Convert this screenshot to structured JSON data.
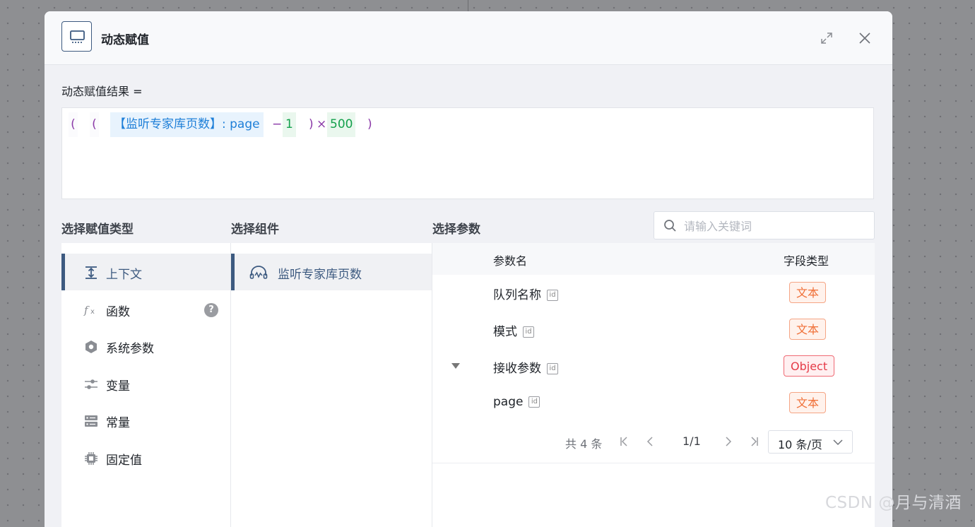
{
  "dialog": {
    "title": "动态赋值"
  },
  "expression": {
    "label": "动态赋值结果 =",
    "tokens": {
      "paren_open_1": "(",
      "paren_open_2": "(",
      "field": "【监听专家库页数】: page",
      "minus": "−",
      "num1": "1",
      "paren_close_1": ")",
      "times": "×",
      "num2": "500",
      "paren_close_2": ")"
    }
  },
  "sections": {
    "assign_type": "选择赋值类型",
    "component": "选择组件",
    "param": "选择参数"
  },
  "search": {
    "placeholder": "请输入关键词"
  },
  "assign_types": [
    {
      "label": "上下文",
      "icon": "vertical-align-icon",
      "active": true
    },
    {
      "label": "函数",
      "icon": "function-icon",
      "help": "?"
    },
    {
      "label": "系统参数",
      "icon": "hexagon-icon"
    },
    {
      "label": "变量",
      "icon": "sliders-icon"
    },
    {
      "label": "常量",
      "icon": "server-icon"
    },
    {
      "label": "固定值",
      "icon": "chip-icon"
    }
  ],
  "components": [
    {
      "label": "监听专家库页数",
      "icon": "headset-icon",
      "active": true
    }
  ],
  "table": {
    "headers": {
      "name": "参数名",
      "type": "字段类型"
    },
    "id_badge": "id",
    "rows": [
      {
        "name": "队列名称",
        "type": "文本"
      },
      {
        "name": "模式",
        "type": "文本"
      },
      {
        "name": "接收参数",
        "type": "Object",
        "expandable": true
      },
      {
        "name": "page",
        "type": "文本"
      }
    ]
  },
  "pagination": {
    "total": "共 4 条",
    "page": "1/1",
    "size": "10 条/页"
  },
  "colors": {
    "accent": "#3d5a80",
    "text_tag": "#f07038",
    "object_tag": "#e53a47",
    "field_token": "#1e7fd8",
    "number_token": "#14a04c"
  },
  "watermark": "CSDN @月与清酒"
}
